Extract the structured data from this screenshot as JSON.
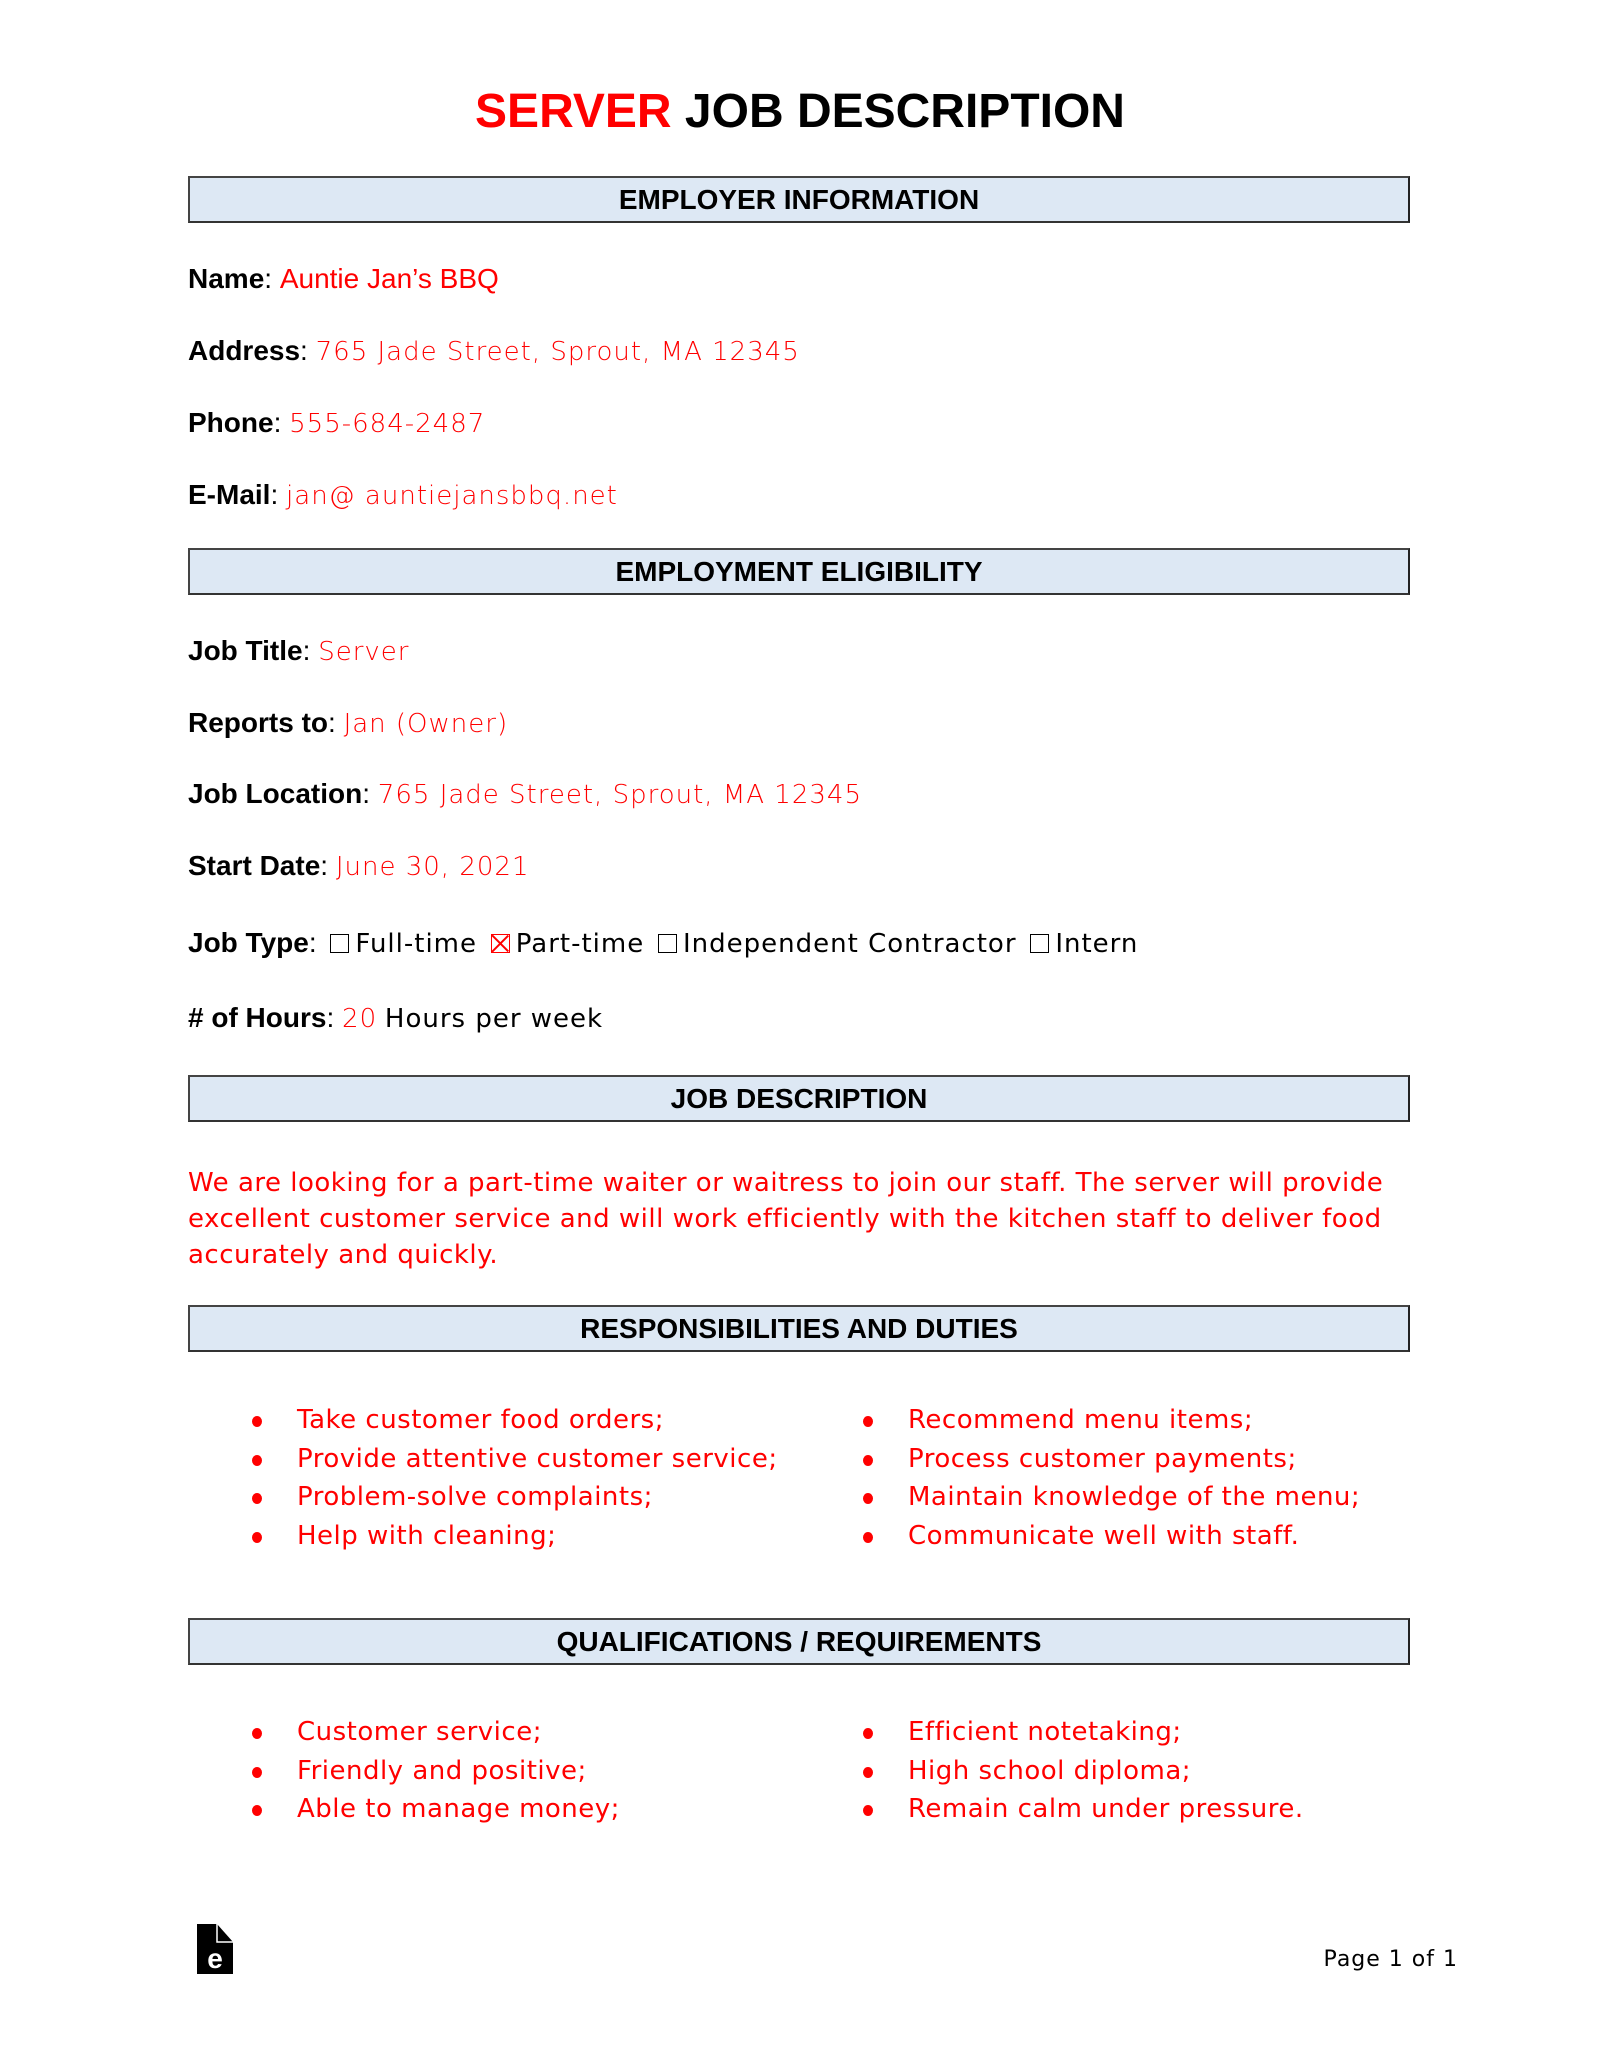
{
  "title": {
    "highlight": "SERVER",
    "rest": "JOB DESCRIPTION"
  },
  "colors": {
    "accent": "#ff0000",
    "section_bg": "#dde8f4"
  },
  "sections": {
    "employer": "EMPLOYER INFORMATION",
    "eligibility": "EMPLOYMENT ELIGIBILITY",
    "description": "JOB DESCRIPTION",
    "responsibilities": "RESPONSIBILITIES AND DUTIES",
    "qualifications": "QUALIFICATIONS / REQUIREMENTS"
  },
  "employer": {
    "name": {
      "label": "Name",
      "value": "Auntie Jan’s BBQ"
    },
    "address": {
      "label": "Address",
      "value": "765 Jade Street, Sprout, MA 12345"
    },
    "phone": {
      "label": "Phone",
      "value": "555-684-2487"
    },
    "email": {
      "label": "E-Mail",
      "value": "jan@ auntiejansbbq.net"
    }
  },
  "eligibility": {
    "job_title": {
      "label": "Job Title",
      "value": "Server"
    },
    "reports_to": {
      "label": "Reports to",
      "value": "Jan (Owner)"
    },
    "job_location": {
      "label": "Job Location",
      "value": "765 Jade Street, Sprout, MA 12345"
    },
    "start_date": {
      "label": "Start Date",
      "value": "June 30, 2021"
    },
    "job_type": {
      "label": "Job Type",
      "options": [
        {
          "label": "Full-time",
          "checked": false
        },
        {
          "label": "Part-time",
          "checked": true
        },
        {
          "label": "Independent Contractor",
          "checked": false
        },
        {
          "label": "Intern",
          "checked": false
        }
      ]
    },
    "hours": {
      "label": "# of Hours",
      "value": "20",
      "suffix": "Hours per week"
    }
  },
  "description": "We are looking for a part-time waiter or waitress to join our staff. The server will provide excellent customer service and will work efficiently with the kitchen staff to deliver food accurately and quickly.",
  "responsibilities": {
    "left": [
      "Take customer food orders;",
      "Provide attentive customer service;",
      "Problem-solve complaints;",
      "Help with cleaning;"
    ],
    "right": [
      "Recommend menu items;",
      "Process customer payments;",
      "Maintain knowledge of the menu;",
      "Communicate well with staff."
    ]
  },
  "qualifications": {
    "left": [
      "Customer service;",
      "Friendly and positive;",
      "Able to manage money;"
    ],
    "right": [
      "Efficient notetaking;",
      "High school diploma;",
      "Remain calm under pressure."
    ]
  },
  "footer": {
    "logo_icon": "eforms-logo-icon",
    "page": "Page 1 of 1"
  }
}
